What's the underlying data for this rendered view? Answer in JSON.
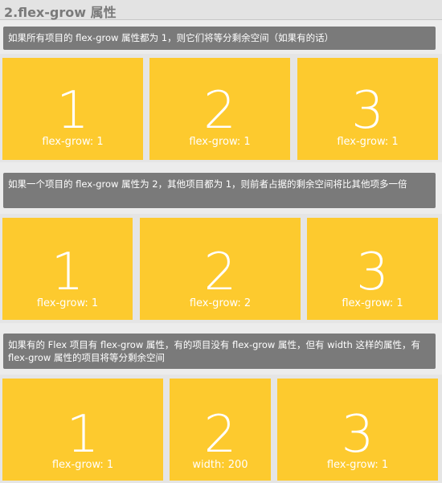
{
  "header": {
    "title": "2.flex-grow 属性"
  },
  "sections": [
    {
      "note": "如果所有项目的 flex-grow 属性都为 1，则它们将等分剩余空间（如果有的话）",
      "items": [
        {
          "number": "1",
          "label": "flex-grow: 1"
        },
        {
          "number": "2",
          "label": "flex-grow: 1"
        },
        {
          "number": "3",
          "label": "flex-grow: 1"
        }
      ]
    },
    {
      "note": "如果一个项目的 flex-grow 属性为 2，其他项目都为 1，则前者占据的剩余空间将比其他项多一倍",
      "items": [
        {
          "number": "1",
          "label": "flex-grow: 1"
        },
        {
          "number": "2",
          "label": "flex-grow: 2"
        },
        {
          "number": "3",
          "label": "flex-grow: 1"
        }
      ]
    },
    {
      "note": "如果有的 Flex 项目有 flex-grow 属性，有的项目没有 flex-grow 属性，但有 width 这样的属性，有 flex-grow 属性的项目将等分剩余空间",
      "items": [
        {
          "number": "1",
          "label": "flex-grow: 1"
        },
        {
          "number": "2",
          "label": "width: 200"
        },
        {
          "number": "3",
          "label": "flex-grow: 1"
        }
      ]
    }
  ],
  "colors": {
    "box": "#fdca2e",
    "note": "#7a7a7a",
    "title": "#7a7a7a"
  }
}
